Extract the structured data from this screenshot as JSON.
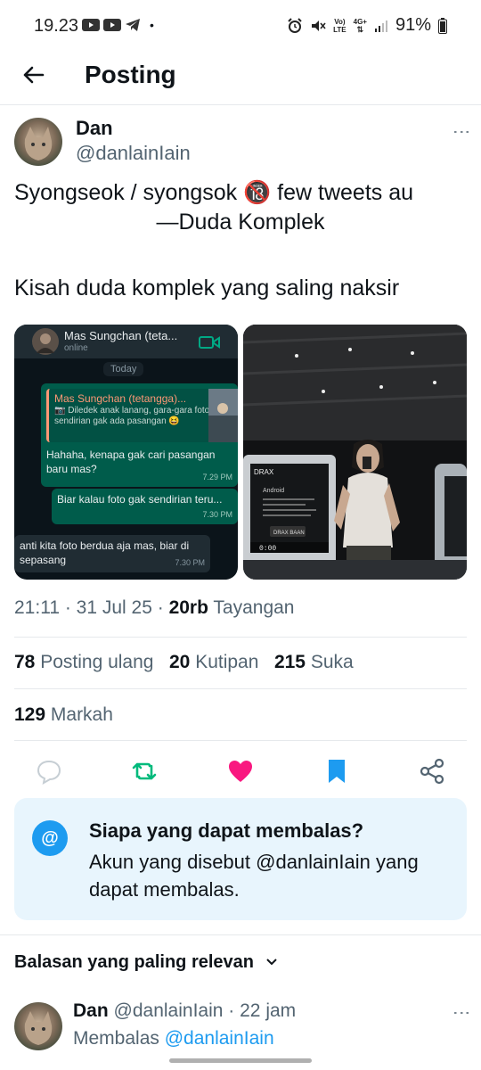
{
  "status_bar": {
    "time": "19.23",
    "dot": "•",
    "net_label_top": "Vo)",
    "net_label_bottom": "LTE",
    "net_gen": "4G+",
    "battery": "91%"
  },
  "header": {
    "title": "Posting"
  },
  "post": {
    "author_name": "Dan",
    "author_handle": "@danlainIain",
    "line1": "Syongseok / syongsok 🔞 few tweets au",
    "line2": "—Duda Komplek",
    "line3": "Kisah duda komplek yang saling naksir",
    "chat": {
      "contact": "Mas Sungchan (teta...",
      "status": "online",
      "day": "Today",
      "quote_name": "Mas Sungchan (tetangga)...",
      "quote_text": "Diledek anak lanang, gara-gara foto sendirian gak ada pasangan 😆",
      "msg1": "Hahaha, kenapa gak cari pasangan baru mas?",
      "msg1_time": "7.29 PM",
      "msg2": "Biar kalau foto gak sendirian teru...",
      "msg2_time": "7.30 PM",
      "msg3": "anti kita foto berdua aja mas, biar di sepasang",
      "msg3_time": "7.30 PM"
    },
    "gym_screen": {
      "brand": "DRAX",
      "app": "Android",
      "button": "DRAX BAAN",
      "digits": "0:00"
    },
    "time": "21:11",
    "date": "31 Jul 25",
    "views_count": "20rb",
    "views_label": "Tayangan",
    "reposts_count": "78",
    "reposts_label": "Posting ulang",
    "quotes_count": "20",
    "quotes_label": "Kutipan",
    "likes_count": "215",
    "likes_label": "Suka",
    "bookmarks_count": "129",
    "bookmarks_label": "Markah"
  },
  "actions": {
    "reply_icon": "reply-icon",
    "repost_icon": "repost-icon",
    "like_icon": "heart-icon",
    "bookmark_icon": "bookmark-icon",
    "share_icon": "share-icon"
  },
  "reply_info": {
    "title": "Siapa yang dapat membalas?",
    "text": "Akun yang disebut @danlainIain yang dapat membalas."
  },
  "sort_label": "Balasan yang paling relevan",
  "reply": {
    "name": "Dan",
    "handle": "@danlainIain",
    "sep": "·",
    "age": "22 jam",
    "replying_prefix": "Membalas",
    "replying_to": "@danlainIain"
  },
  "colors": {
    "accent": "#1d9bf0",
    "repost_green": "#00ba7c",
    "like_pink": "#f91880",
    "text": "#0f1419",
    "secondary": "#536471"
  }
}
